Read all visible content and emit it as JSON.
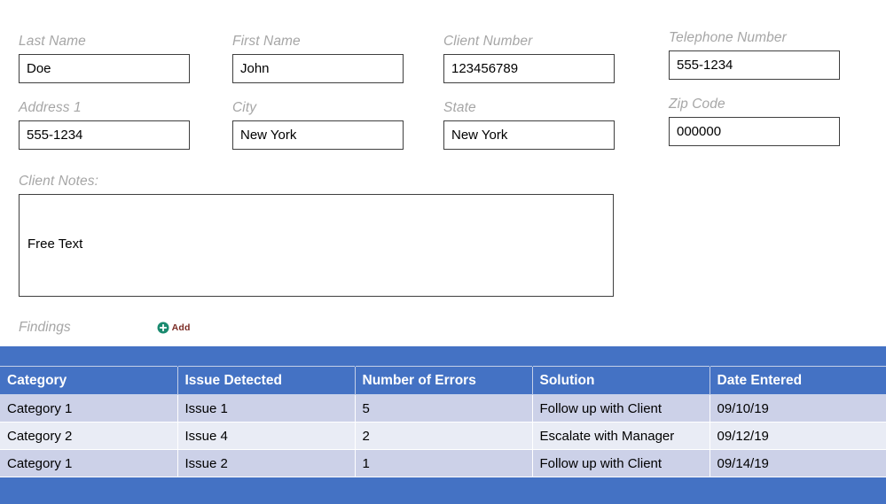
{
  "form": {
    "fields": [
      {
        "label": "Last Name",
        "value": "Doe",
        "name": "last-name"
      },
      {
        "label": "First Name",
        "value": "John",
        "name": "first-name"
      },
      {
        "label": "Client Number",
        "value": "123456789",
        "name": "client-number"
      },
      {
        "label": "Telephone Number",
        "value": "555-1234",
        "name": "telephone-number"
      },
      {
        "label": "Address 1",
        "value": "555-1234",
        "name": "address-1"
      },
      {
        "label": "City",
        "value": "New York",
        "name": "city"
      },
      {
        "label": "State",
        "value": "New York",
        "name": "state"
      },
      {
        "label": "Zip Code",
        "value": "000000",
        "name": "zip-code"
      }
    ],
    "notes": {
      "label": "Client Notes:",
      "value": "Free Text"
    }
  },
  "findings": {
    "label": "Findings",
    "add_label": "Add",
    "add_icon": "plus-circle-icon",
    "columns": [
      "Category",
      "Issue Detected",
      "Number of Errors",
      "Solution",
      "Date Entered"
    ],
    "rows": [
      [
        "Category 1",
        "Issue 1",
        "5",
        "Follow up with Client",
        "09/10/19"
      ],
      [
        "Category 2",
        "Issue 4",
        "2",
        "Escalate with Manager",
        "09/12/19"
      ],
      [
        "Category 1",
        "Issue 2",
        "1",
        "Follow up with Client",
        "09/14/19"
      ]
    ]
  },
  "colors": {
    "table_blue": "#4472c4",
    "row_odd": "#ccd1e8",
    "row_even": "#e9ecf5",
    "label_gray": "#a6a6a6",
    "add_icon_teal": "#1a8a6f",
    "add_label_maroon": "#7b2c25"
  }
}
